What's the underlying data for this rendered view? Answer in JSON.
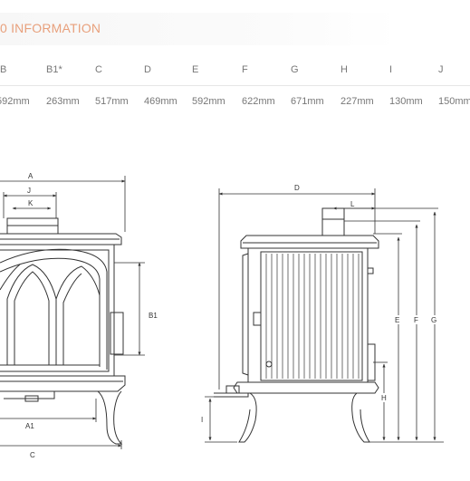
{
  "section_title": "0 INFORMATION",
  "table": {
    "headers": [
      "B",
      "B1*",
      "C",
      "D",
      "E",
      "F",
      "G",
      "H",
      "I",
      "J"
    ],
    "values": [
      "592mm",
      "263mm",
      "517mm",
      "469mm",
      "592mm",
      "622mm",
      "671mm",
      "227mm",
      "130mm",
      "150mm"
    ]
  },
  "diagram_labels": {
    "A": "A",
    "J": "J",
    "K": "K",
    "B1": "B1",
    "A1": "A1",
    "C": "C",
    "D": "D",
    "L": "L",
    "E": "E",
    "F": "F",
    "G": "G",
    "H": "H",
    "I": "I"
  }
}
